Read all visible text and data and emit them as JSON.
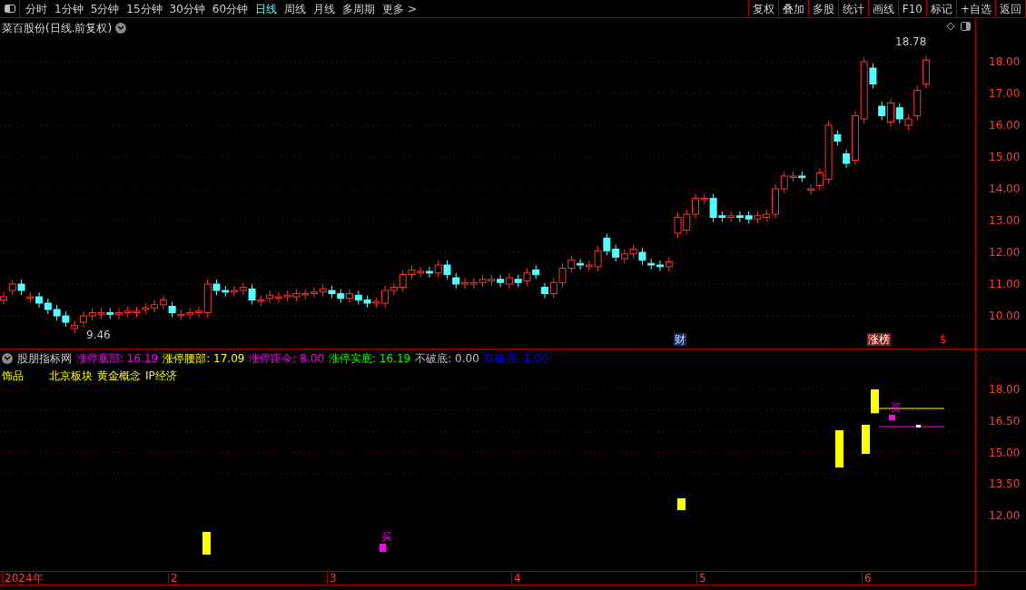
{
  "toolbar": {
    "periods": [
      {
        "label": "分时",
        "selected": false
      },
      {
        "label": "1分钟",
        "selected": false
      },
      {
        "label": "5分钟",
        "selected": false
      },
      {
        "label": "15分钟",
        "selected": false
      },
      {
        "label": "30分钟",
        "selected": false
      },
      {
        "label": "60分钟",
        "selected": false
      },
      {
        "label": "日线",
        "selected": true
      },
      {
        "label": "周线",
        "selected": false
      },
      {
        "label": "月线",
        "selected": false
      },
      {
        "label": "多周期",
        "selected": false
      },
      {
        "label": "更多 >",
        "selected": false
      }
    ],
    "actions": [
      "复权",
      "叠加",
      "多股",
      "统计",
      "画线",
      "F10",
      "标记",
      "+自选",
      "返回"
    ]
  },
  "main_chart": {
    "title": "菜百股份(日线.前复权)",
    "high_label": "18.78",
    "low_label": "9.46",
    "y_axis": [
      "18.00",
      "17.00",
      "16.00",
      "15.00",
      "14.00",
      "13.00",
      "12.00",
      "11.00",
      "10.00"
    ],
    "markers": [
      {
        "text": "财",
        "kind": "finance"
      },
      {
        "text": "涨榜",
        "kind": "limit"
      },
      {
        "text": "$",
        "kind": "dollar"
      }
    ]
  },
  "indicator": {
    "name": "股朋指标网",
    "values": [
      {
        "label": "涨停底部:",
        "value": "16.19",
        "color": "#ff00ff"
      },
      {
        "label": "涨停腰部:",
        "value": "17.09",
        "color": "#ffff00"
      },
      {
        "label": "涨停距今:",
        "value": "8.00",
        "color": "#ff00ff"
      },
      {
        "label": "涨停实底:",
        "value": "16.19",
        "color": "#00ff00"
      },
      {
        "label": "不破底:",
        "value": "0.00",
        "color": "#c0c0c0"
      },
      {
        "label": "跌破底:",
        "value": "1.00",
        "color": "#0000ff"
      }
    ],
    "tags": [
      "饰品",
      "北京板块",
      "黄金概念",
      "IP经济"
    ],
    "buy_labels": [
      "买",
      "买"
    ],
    "y_axis": [
      "18.00",
      "16.50",
      "15.00",
      "13.50",
      "12.00"
    ]
  },
  "time_axis": [
    "2024年",
    "2",
    "3",
    "4",
    "5",
    "6"
  ]
}
